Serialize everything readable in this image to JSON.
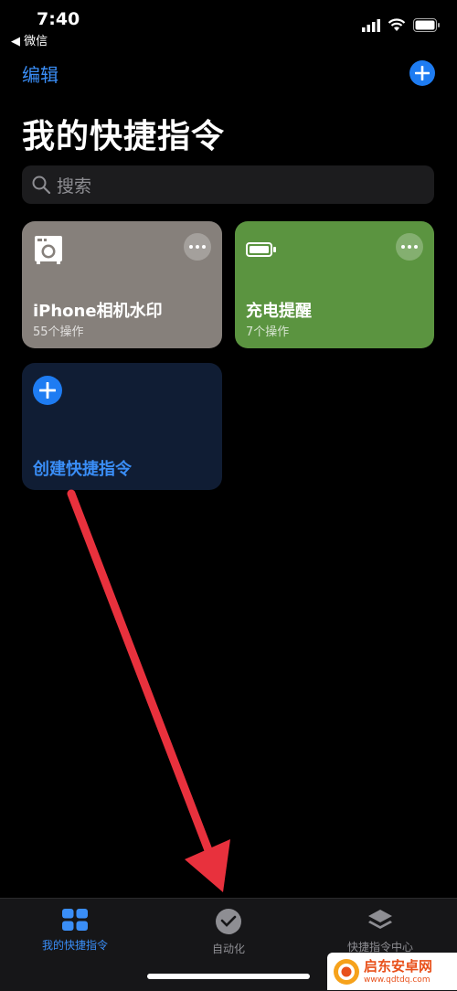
{
  "status_bar": {
    "time": "7:40",
    "back_app": "◀ 微信"
  },
  "header": {
    "edit_label": "编辑",
    "title": "我的快捷指令"
  },
  "search": {
    "placeholder": "搜索"
  },
  "shortcuts": [
    {
      "title": "iPhone相机水印",
      "subtitle": "55个操作",
      "color": "#86807b",
      "icon": "washing-machine-icon"
    },
    {
      "title": "充电提醒",
      "subtitle": "7个操作",
      "color": "#5b9440",
      "icon": "battery-icon"
    }
  ],
  "create": {
    "label": "创建快捷指令"
  },
  "tabs": [
    {
      "label": "我的快捷指令",
      "icon": "grid-icon",
      "active": true
    },
    {
      "label": "自动化",
      "icon": "clock-icon",
      "active": false
    },
    {
      "label": "快捷指令中心",
      "icon": "layers-icon",
      "active": false
    }
  ],
  "watermark": {
    "name": "启东安卓网",
    "url": "www.qdtdq.com"
  },
  "colors": {
    "accent": "#1e7cf2",
    "arrow": "#e8313d"
  }
}
